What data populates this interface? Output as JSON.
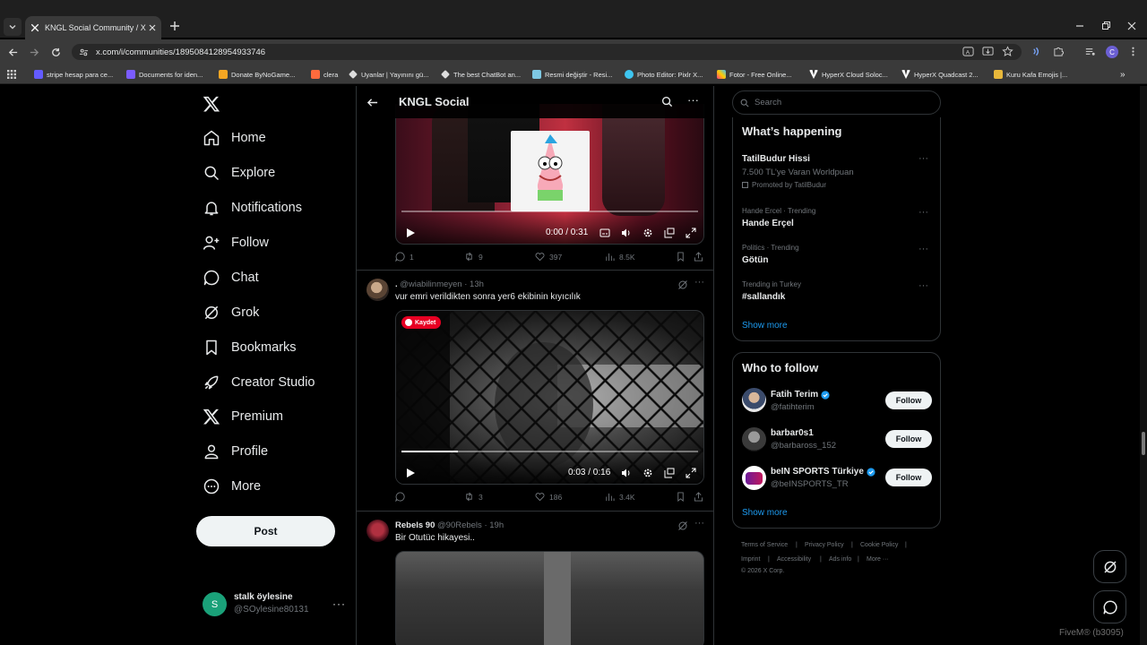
{
  "browser": {
    "tab_title": "KNGL Social Community / X",
    "url": "x.com/i/communities/1895084128954933746",
    "bookmarks": [
      {
        "label": "stripe hesap para ce...",
        "color": "#635bff"
      },
      {
        "label": "Documents for iden...",
        "color": "#7b5cff"
      },
      {
        "label": "Donate ByNoGame...",
        "color": "#f5a623"
      },
      {
        "label": "clera",
        "color": "#ff6b3d"
      },
      {
        "label": "Uyanlar | Yayınını gü...",
        "color": "#ffffff"
      },
      {
        "label": "The best ChatBot an...",
        "color": "#ffffff"
      },
      {
        "label": "Resmi değiştir - Resi...",
        "color": "#7ec8e3"
      },
      {
        "label": "Photo Editor: Pixlr X...",
        "color": "#3ec5f0"
      },
      {
        "label": "Fotor - Free Online...",
        "color": "#ffcc00"
      },
      {
        "label": "HyperX Cloud Soloc...",
        "color": "#ffffff"
      },
      {
        "label": "HyperX Quadcast 2...",
        "color": "#ffffff"
      },
      {
        "label": "Kuru Kafa Emojis |...",
        "color": "#e8b83b"
      }
    ],
    "profile_initial": "C"
  },
  "nav": {
    "items": [
      {
        "label": "Home",
        "icon": "home-icon"
      },
      {
        "label": "Explore",
        "icon": "search-icon"
      },
      {
        "label": "Notifications",
        "icon": "bell-icon"
      },
      {
        "label": "Follow",
        "icon": "person-add-icon"
      },
      {
        "label": "Chat",
        "icon": "chat-icon"
      },
      {
        "label": "Grok",
        "icon": "grok-icon"
      },
      {
        "label": "Bookmarks",
        "icon": "bookmark-icon"
      },
      {
        "label": "Creator Studio",
        "icon": "rocket-icon"
      },
      {
        "label": "Premium",
        "icon": "x-icon"
      },
      {
        "label": "Profile",
        "icon": "person-icon"
      },
      {
        "label": "More",
        "icon": "more-circle-icon"
      }
    ],
    "post_label": "Post",
    "account": {
      "initial": "S",
      "name": "stalk öylesine",
      "handle": "@SOylesine80131",
      "more": "···"
    }
  },
  "main": {
    "title": "KNGL Social",
    "tweets": [
      {
        "video_time": "0:00 / 0:31",
        "progress": 0.0,
        "replies": "1",
        "reposts": "9",
        "likes": "397",
        "views": "8.5K"
      },
      {
        "name": ".",
        "handle": "@wiabilinmeyen",
        "time": "13h",
        "text": "vur emri verildikten sonra yer6 ekibinin kıyıcılık",
        "badge": "Kaydet",
        "video_time": "0:03 / 0:16",
        "progress": 0.19,
        "replies": "",
        "reposts": "3",
        "likes": "186",
        "views": "3.4K"
      },
      {
        "name": "Rebels 90",
        "handle": "@90Rebels",
        "time": "19h",
        "text": "Bir Otutüc hikayesi.."
      }
    ]
  },
  "sidebar": {
    "search_placeholder": "Search",
    "whats_happening": {
      "title": "What’s happening",
      "trends": [
        {
          "main": "TatilBudur Hissi",
          "sub1": "7.500 TL’ye Varan Worldpuan",
          "sub2": "Promoted by TatilBudur"
        },
        {
          "context": "Hande Ercel · Trending",
          "main": "Hande Erçel"
        },
        {
          "context": "Politics · Trending",
          "main": "Götün"
        },
        {
          "context": "Trending in Turkey",
          "main": "#sallandık"
        }
      ],
      "show_more": "Show more"
    },
    "who_to_follow": {
      "title": "Who to follow",
      "accounts": [
        {
          "name": "Fatih Terim",
          "handle": "@fatihterim",
          "verified": true
        },
        {
          "name": "barbar0s1",
          "handle": "@barbaross_152",
          "verified": false
        },
        {
          "name": "beIN SPORTS Türkiye",
          "handle": "@beINSPORTS_TR",
          "verified": true
        }
      ],
      "follow_label": "Follow",
      "show_more": "Show more"
    },
    "footer": {
      "links": [
        "Terms of Service",
        "Privacy Policy",
        "Cookie Policy",
        "Imprint",
        "Accessibility",
        "Ads info",
        "More ···"
      ],
      "copyright": "© 2026 X Corp."
    }
  },
  "overlay": {
    "text": "FiveM® (b3095)"
  },
  "colors": {
    "accent": "#1d9bf0",
    "background": "#000000",
    "border": "#2f3336",
    "muted": "#71767b"
  }
}
